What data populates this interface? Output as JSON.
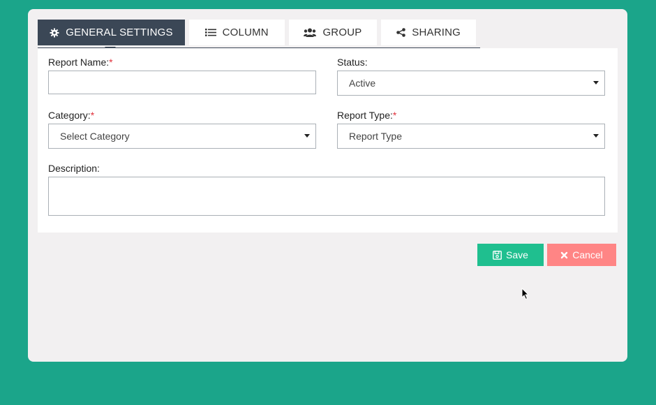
{
  "tabs": [
    {
      "label": "GENERAL SETTINGS",
      "icon": "gear-icon",
      "active": true
    },
    {
      "label": "COLUMN",
      "icon": "list-icon",
      "active": false
    },
    {
      "label": "GROUP",
      "icon": "users-icon",
      "active": false
    },
    {
      "label": "SHARING",
      "icon": "share-icon",
      "active": false
    }
  ],
  "form": {
    "report_name": {
      "label": "Report Name:",
      "required_mark": "*",
      "value": ""
    },
    "status": {
      "label": "Status:",
      "value": "Active"
    },
    "category": {
      "label": "Category:",
      "required_mark": "*",
      "value": "Select Category"
    },
    "report_type": {
      "label": "Report Type:",
      "required_mark": "*",
      "value": "Report Type"
    },
    "description": {
      "label": "Description:",
      "value": ""
    }
  },
  "actions": {
    "save_label": "Save",
    "cancel_label": "Cancel",
    "save_color": "#1fbf8f",
    "cancel_color": "#ff8585"
  }
}
